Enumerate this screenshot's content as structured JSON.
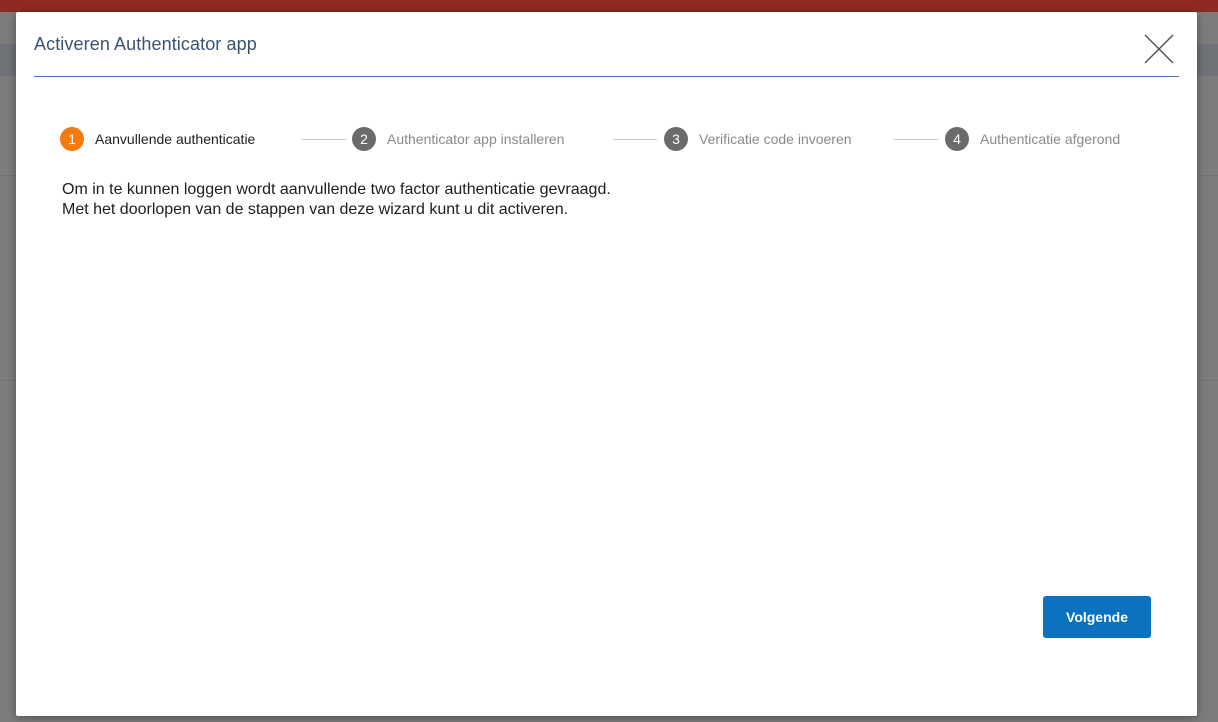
{
  "dialog": {
    "title": "Activeren Authenticator app",
    "close_icon": "close-icon"
  },
  "stepper": {
    "steps": [
      {
        "number": "1",
        "label": "Aanvullende authenticatie",
        "state": "active",
        "color": "#f47a10"
      },
      {
        "number": "2",
        "label": "Authenticator app installeren",
        "state": "inactive",
        "color": "#6b6b6b"
      },
      {
        "number": "3",
        "label": "Verificatie code invoeren",
        "state": "inactive",
        "color": "#6b6b6b"
      },
      {
        "number": "4",
        "label": "Authenticatie afgerond",
        "state": "inactive",
        "color": "#6b6b6b"
      }
    ]
  },
  "content": {
    "line1": "Om in te kunnen loggen wordt aanvullende two factor authenticatie gevraagd.",
    "line2": "Met het doorlopen van de stappen van deze wizard kunt u dit activeren."
  },
  "footer": {
    "next_label": "Volgende"
  },
  "colors": {
    "accent": "#0b72bf",
    "active_step": "#f47a10",
    "inactive_step": "#6b6b6b",
    "title": "#3a5373"
  }
}
